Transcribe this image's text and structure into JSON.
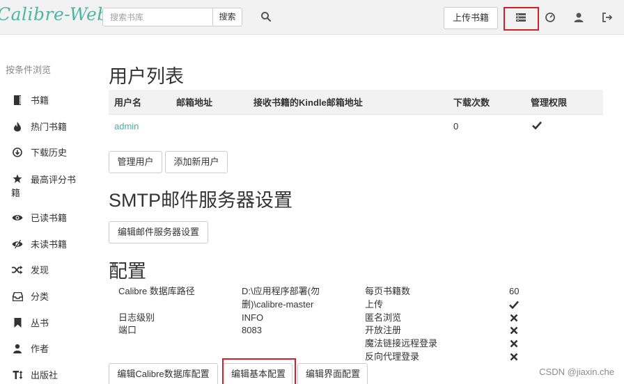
{
  "brand": "Calibre-Web",
  "search": {
    "placeholder": "搜索书库",
    "button": "搜索"
  },
  "header": {
    "upload_label": "上传书籍"
  },
  "sidebar": {
    "heading": "按条件浏览",
    "items": [
      {
        "label": "书籍",
        "icon": "book-icon"
      },
      {
        "label": "热门书籍",
        "icon": "fire-icon"
      },
      {
        "label": "下载历史",
        "icon": "download-icon"
      },
      {
        "label": "最高评分书籍",
        "icon": "star-icon"
      },
      {
        "label": "已读书籍",
        "icon": "eye-icon"
      },
      {
        "label": "未读书籍",
        "icon": "eye-slash-icon"
      },
      {
        "label": "发现",
        "icon": "shuffle-icon"
      },
      {
        "label": "分类",
        "icon": "inbox-icon"
      },
      {
        "label": "丛书",
        "icon": "bookmark-icon"
      },
      {
        "label": "作者",
        "icon": "user-icon"
      },
      {
        "label": "出版社",
        "icon": "text-height-icon"
      }
    ]
  },
  "users_section": {
    "title": "用户列表",
    "columns": [
      "用户名",
      "邮箱地址",
      "接收书籍的Kindle邮箱地址",
      "下载次数",
      "管理权限"
    ],
    "rows": [
      {
        "username": "admin",
        "email": "",
        "kindle": "",
        "downloads": "0",
        "admin": true
      }
    ],
    "manage_users_button": "管理用户",
    "add_user_button": "添加新用户"
  },
  "smtp_section": {
    "title": "SMTP邮件服务器设置",
    "edit_button": "编辑邮件服务器设置"
  },
  "config_section": {
    "title": "配置",
    "left": [
      {
        "label": "Calibre 数据库路径",
        "value_line1": "D:\\应用程序部署(勿",
        "value_line2": "删)\\calibre-master"
      },
      {
        "label": "日志级别",
        "value": "INFO"
      },
      {
        "label": "端口",
        "value": "8083"
      }
    ],
    "right": [
      {
        "label": "每页书籍数",
        "value": "60",
        "kind": "text"
      },
      {
        "label": "上传",
        "value": true,
        "kind": "check"
      },
      {
        "label": "匿名浏览",
        "value": false,
        "kind": "check"
      },
      {
        "label": "开放注册",
        "value": false,
        "kind": "check"
      },
      {
        "label": "魔法链接远程登录",
        "value": false,
        "kind": "check"
      },
      {
        "label": "反向代理登录",
        "value": false,
        "kind": "check"
      }
    ],
    "buttons": {
      "edit_db": "编辑Calibre数据库配置",
      "edit_basic": "编辑基本配置",
      "edit_ui": "编辑界面配置"
    }
  },
  "watermark": "CSDN @jiaxin.che",
  "colors": {
    "accent": "#45b29d",
    "highlight": "#d0202a"
  }
}
